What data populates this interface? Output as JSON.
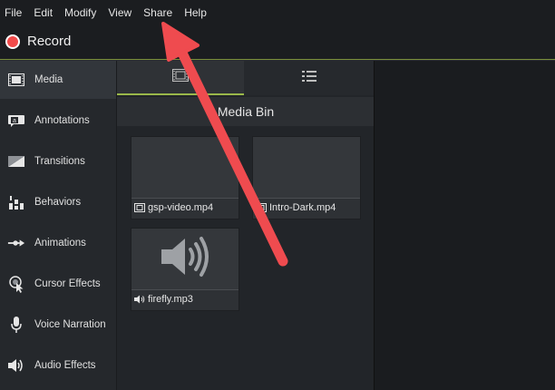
{
  "menu": {
    "items": [
      "File",
      "Edit",
      "Modify",
      "View",
      "Share",
      "Help"
    ]
  },
  "record": {
    "label": "Record",
    "color": "#f24b4b"
  },
  "sidebar": {
    "items": [
      {
        "label": "Media",
        "icon": "film-strip-icon",
        "active": true
      },
      {
        "label": "Annotations",
        "icon": "callout-icon"
      },
      {
        "label": "Transitions",
        "icon": "transition-icon"
      },
      {
        "label": "Behaviors",
        "icon": "behaviors-icon"
      },
      {
        "label": "Animations",
        "icon": "animation-arrow-icon"
      },
      {
        "label": "Cursor Effects",
        "icon": "cursor-effects-icon"
      },
      {
        "label": "Voice Narration",
        "icon": "microphone-icon"
      },
      {
        "label": "Audio Effects",
        "icon": "speaker-icon"
      }
    ]
  },
  "panel": {
    "tabs": [
      {
        "icon": "film-strip-icon",
        "active": true
      },
      {
        "icon": "list-view-icon",
        "active": false
      }
    ],
    "title": "Media Bin",
    "clips": [
      {
        "name": "gsp-video.mp4",
        "type": "video"
      },
      {
        "name": "Intro-Dark.mp4",
        "type": "video"
      },
      {
        "name": "firefly.mp3",
        "type": "audio"
      }
    ]
  },
  "colors": {
    "accent": "#9ab84a",
    "annotation_arrow": "#ef4b4f"
  }
}
